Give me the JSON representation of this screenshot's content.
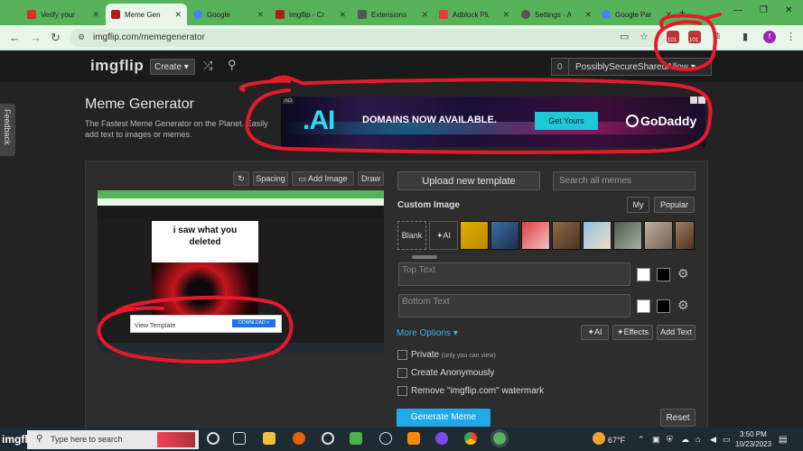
{
  "browser": {
    "tabs": [
      {
        "label": "Verify your I",
        "color": "#d93025"
      },
      {
        "label": "Meme Gene",
        "color": "#b71c1c",
        "active": true
      },
      {
        "label": "Google",
        "color": "#4285f4"
      },
      {
        "label": "Imgflip - Cr",
        "color": "#b71c1c"
      },
      {
        "label": "Extensions",
        "color": "#555555"
      },
      {
        "label": "Adblock Plu",
        "color": "#e53935"
      },
      {
        "label": "Settings - A",
        "color": "#555555"
      },
      {
        "label": "Google Par",
        "color": "#4285f4"
      }
    ],
    "url": "imgflip.com/memegenerator",
    "badge": "101",
    "profile_initial": "f"
  },
  "site": {
    "logo_img": "img",
    "logo_flip": "flip",
    "create_label": "Create ▾",
    "account_count": "0",
    "account_name": "PossiblySecureSharedAllow ▾",
    "title": "Meme Generator",
    "subtitle": "The Fastest Meme Generator on the Planet. Easily add text to images or memes.",
    "feedback": "Feedback"
  },
  "ad": {
    "tag": "AD",
    "logo": ".AI",
    "headline": "DOMAINS NOW AVAILABLE.",
    "cta": "Get Yours",
    "brand": "GoDaddy"
  },
  "editor": {
    "spacing": "Spacing",
    "add_image": "Add Image",
    "draw": "Draw",
    "upload": "Upload new template",
    "search_placeholder": "Search all memes",
    "custom_image": "Custom Image",
    "tab_my": "My",
    "tab_popular": "Popular",
    "blank": "Blank",
    "ai": "AI",
    "top_text": "Top Text",
    "bottom_text": "Bottom Text",
    "more_options": "More Options ▾",
    "ai_btn": "AI",
    "effects": "Effects",
    "add_text": "Add Text",
    "private": "Private",
    "private_note": "(only you can view)",
    "anonymous": "Create Anonymously",
    "watermark": "Remove \"imgflip.com\" watermark",
    "generate": "Generate Meme",
    "reset": "Reset"
  },
  "preview": {
    "caption": "i saw what you deleted",
    "ad_label": "View Template",
    "ad_button": "DOWNLOAD >"
  },
  "taskbar": {
    "watermark": "imgflip.com",
    "search": "Type here to search",
    "weather": "67°F",
    "time": "3:50 PM",
    "date": "10/23/2023"
  },
  "colors": {
    "accent": "#1fa9e8",
    "chrome_green": "#57b35a",
    "markup_red": "#e8192c"
  }
}
